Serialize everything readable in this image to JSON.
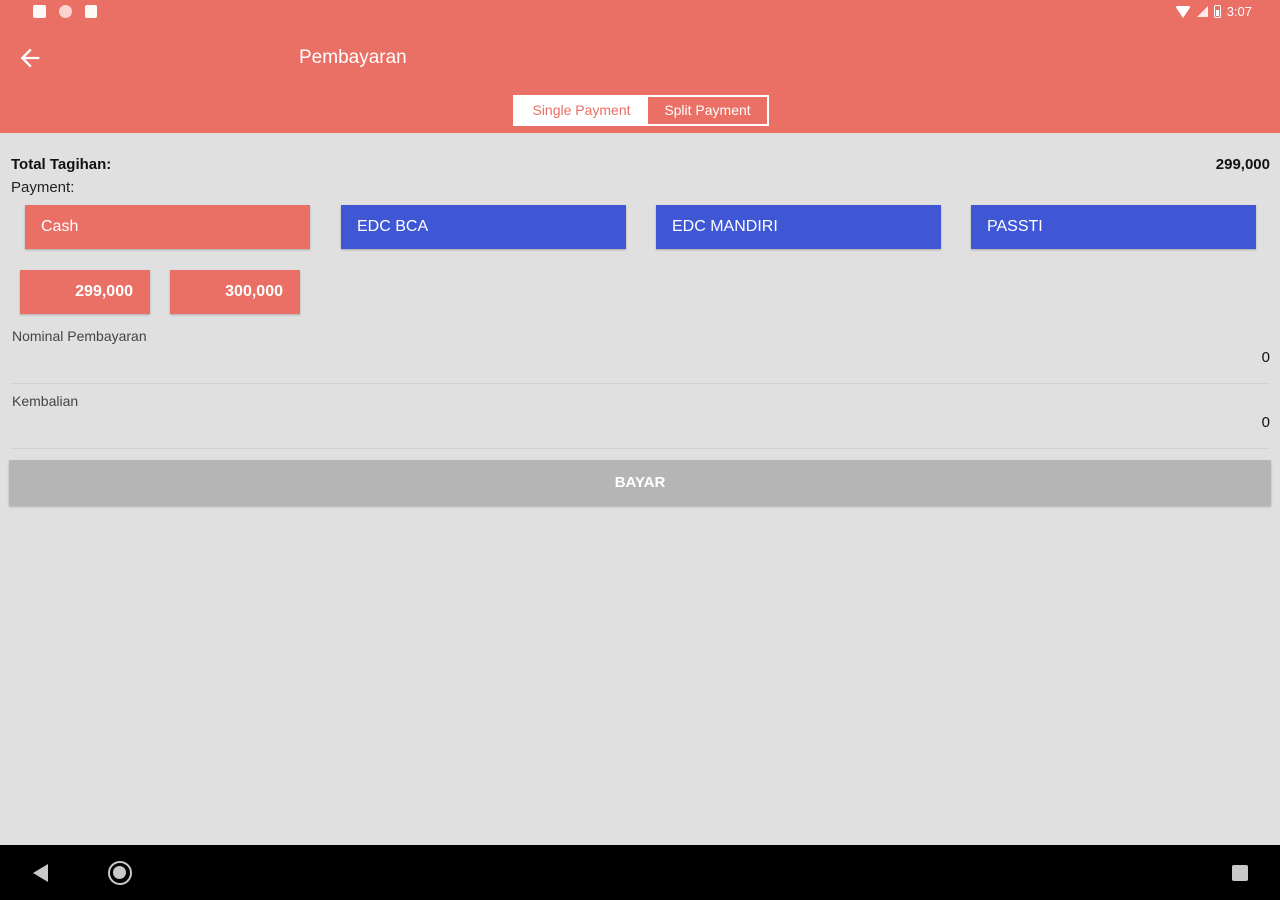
{
  "status_bar": {
    "time": "3:07"
  },
  "header": {
    "title": "Pembayaran",
    "tabs": [
      {
        "label": "Single Payment",
        "active": true
      },
      {
        "label": "Split Payment",
        "active": false
      }
    ]
  },
  "summary": {
    "total_label": "Total Tagihan:",
    "total_value": "299,000",
    "payment_label": "Payment:"
  },
  "payment_methods": [
    {
      "label": "Cash",
      "selected": true
    },
    {
      "label": "EDC BCA",
      "selected": false
    },
    {
      "label": "EDC MANDIRI",
      "selected": false
    },
    {
      "label": "PASSTI",
      "selected": false
    }
  ],
  "quick_amounts": [
    "299,000",
    "300,000"
  ],
  "fields": {
    "nominal_label": "Nominal Pembayaran",
    "nominal_value": "0",
    "change_label": "Kembalian",
    "change_value": "0"
  },
  "actions": {
    "pay_label": "BAYAR"
  },
  "colors": {
    "primary": "#ea6f64",
    "secondary": "#3f57d4",
    "disabled": "#b5b5b5",
    "background": "#e0e0e0"
  }
}
